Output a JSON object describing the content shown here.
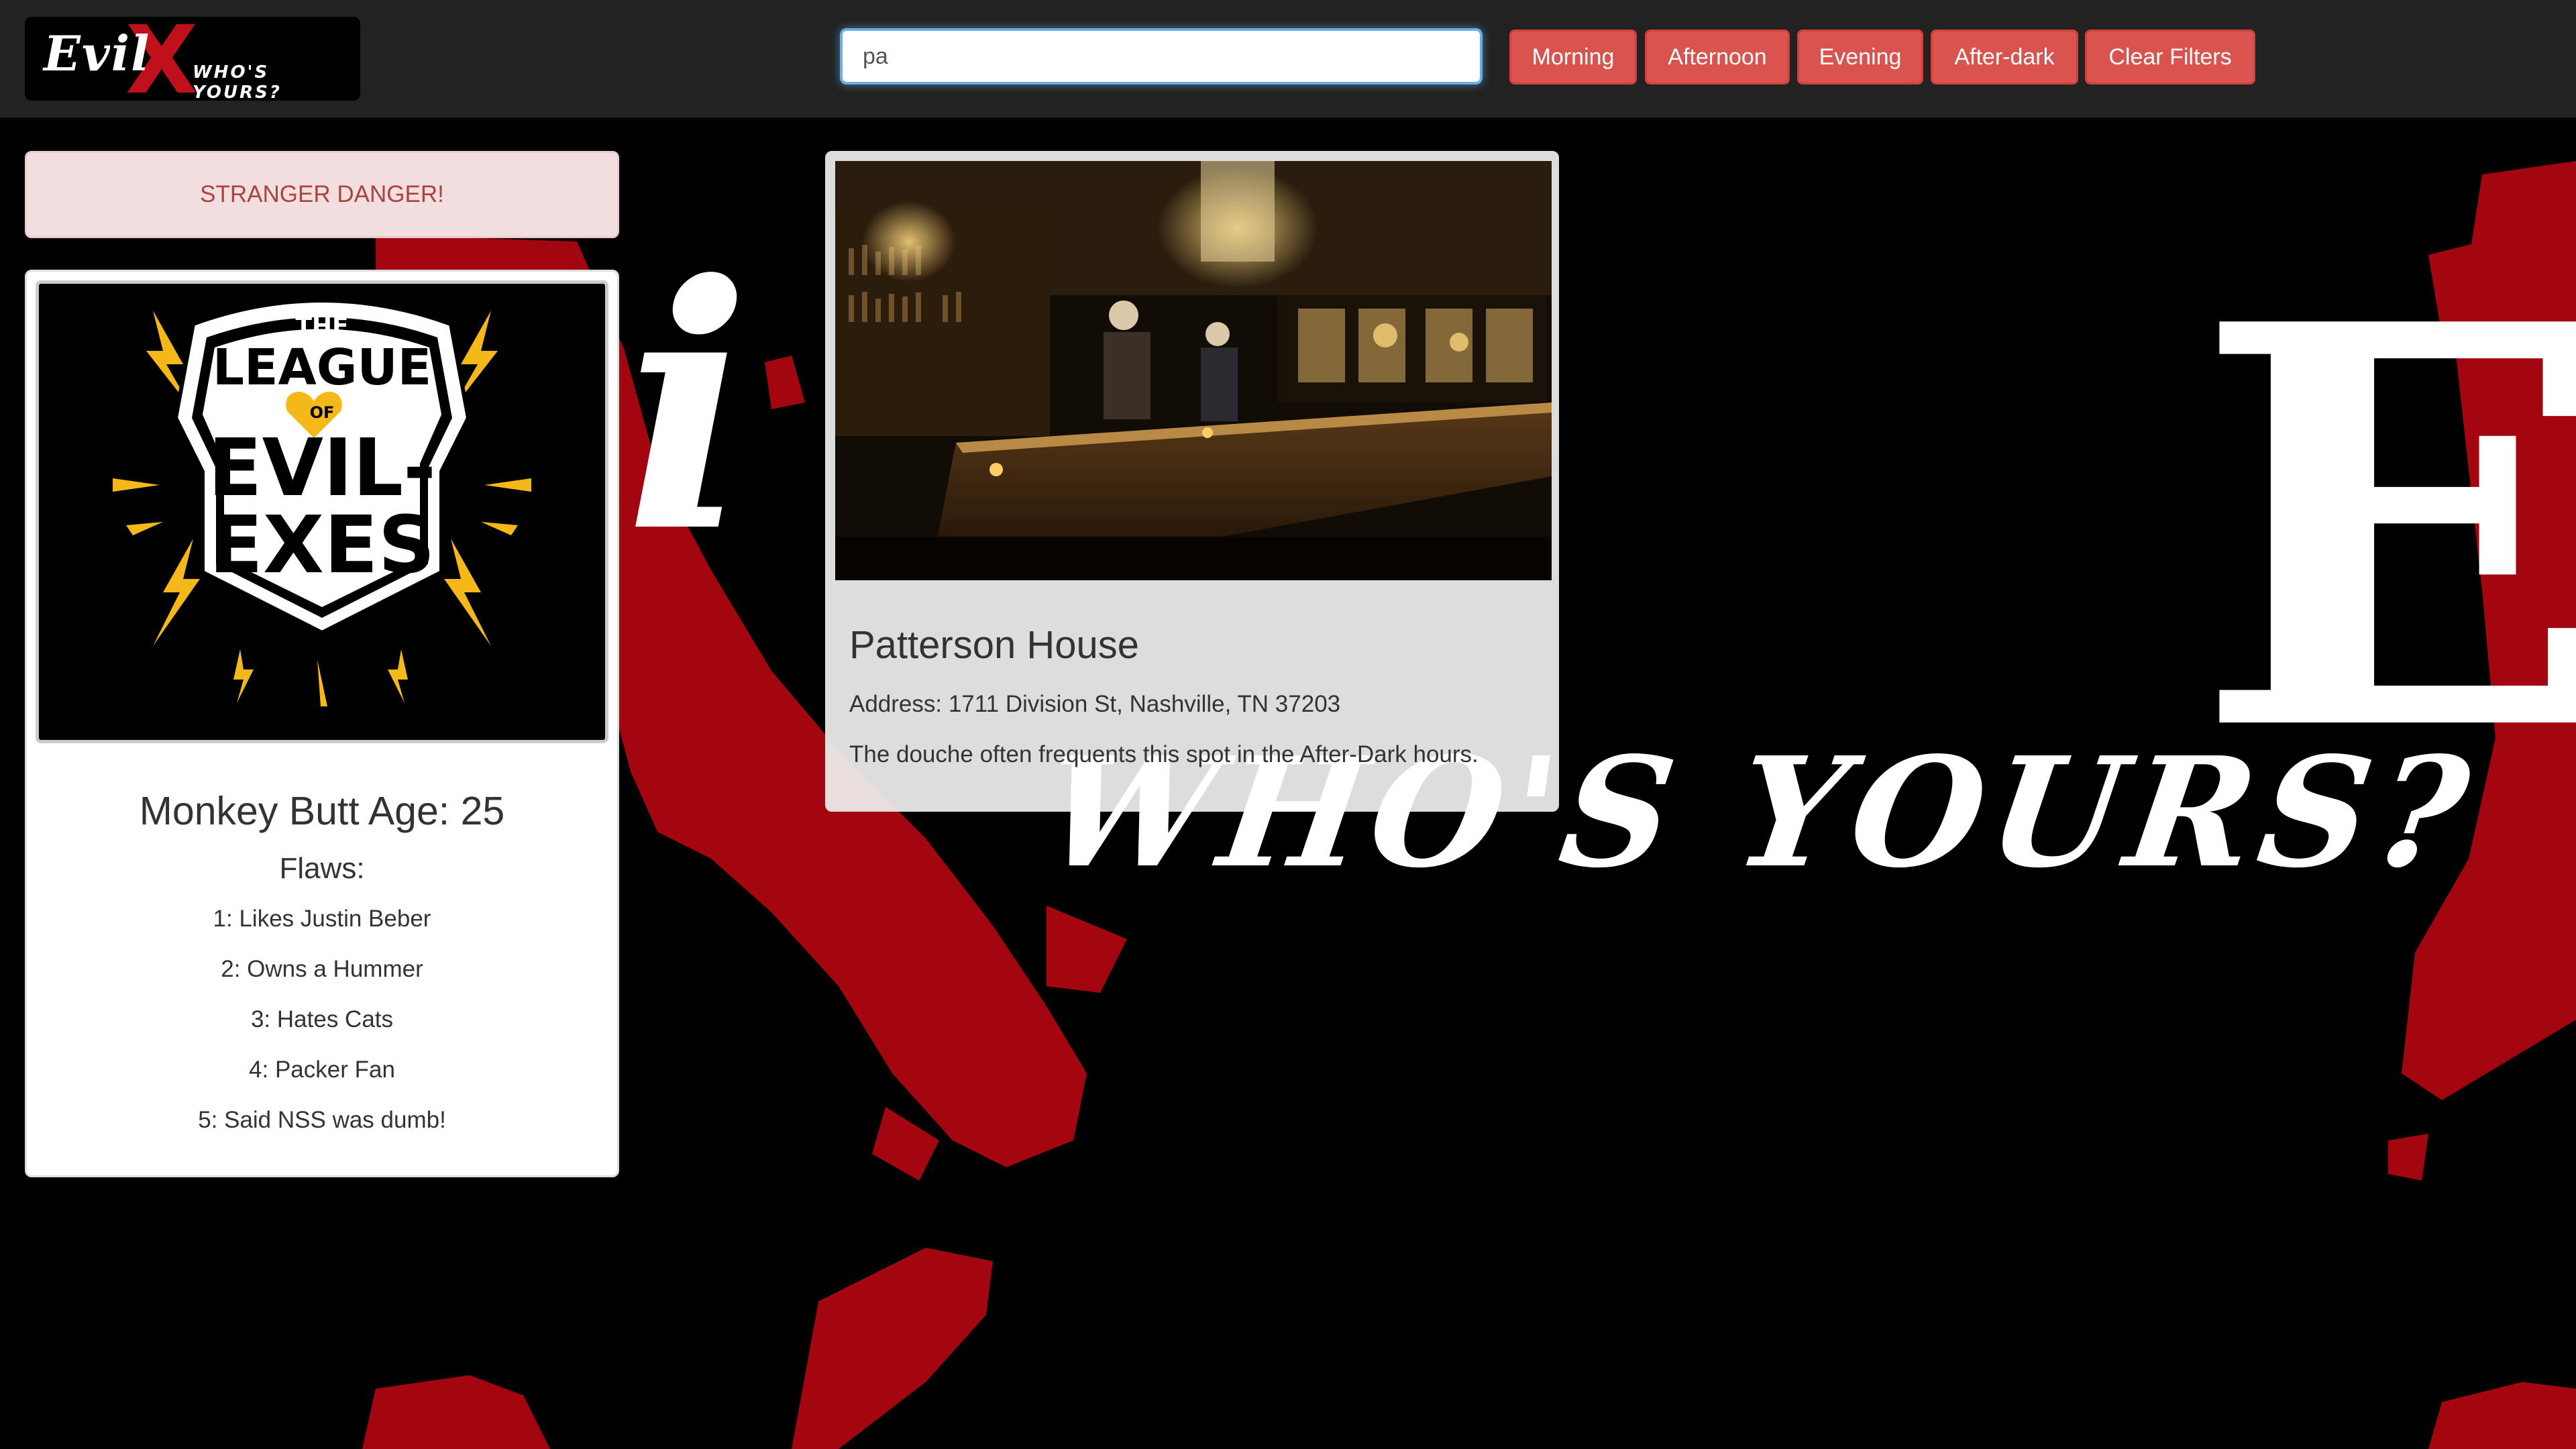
{
  "navbar": {
    "logo": {
      "word": "Evil",
      "mark": "X",
      "tagline": "WHO'S YOURS?"
    },
    "search": {
      "value": "pa",
      "placeholder": ""
    },
    "filters": [
      {
        "label": "Morning"
      },
      {
        "label": "Afternoon"
      },
      {
        "label": "Evening"
      },
      {
        "label": "After-dark"
      },
      {
        "label": "Clear Filters"
      }
    ]
  },
  "alert": {
    "text": "STRANGER DANGER!"
  },
  "profile": {
    "image_alt": "The League of Evil Exes",
    "image_lettering": [
      "THE",
      "LEAGUE",
      "OF",
      "EVIL-",
      "EXES"
    ],
    "name_line": "Monkey Butt Age: 25",
    "flaws_heading": "Flaws:",
    "flaws": [
      "1: Likes Justin Beber",
      "2: Owns a Hummer",
      "3: Hates Cats",
      "4: Packer Fan",
      "5: Said NSS was dumb!"
    ]
  },
  "location": {
    "title": "Patterson House",
    "address": "Address: 1711 Division St, Nashville, TN 37203",
    "note": "The douche often frequents this spot in the After-Dark hours."
  },
  "background": {
    "tagline": "WHO'S YOURS?",
    "letter_left": "i",
    "letter_right": "E"
  },
  "colors": {
    "danger": "#d9534f",
    "blood": "#a3060f",
    "navbar": "#222222",
    "alert_bg": "#f2dede",
    "alert_text": "#a94442"
  }
}
